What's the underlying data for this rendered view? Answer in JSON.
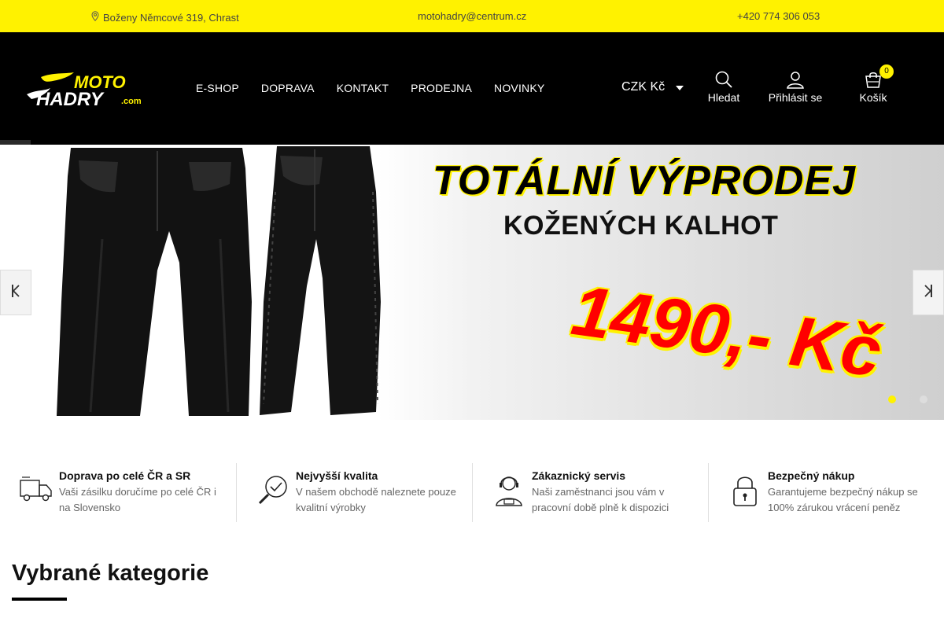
{
  "topbar": {
    "address": "Boženy Němcové 319, Chrast",
    "email": "motohadry@centrum.cz",
    "phone": "+420 774 306 053"
  },
  "logo": {
    "line1": "MOTO",
    "line2": "HADRY",
    "suffix": ".com"
  },
  "nav": {
    "items": [
      {
        "label": "E-SHOP"
      },
      {
        "label": "DOPRAVA"
      },
      {
        "label": "KONTAKT"
      },
      {
        "label": "PRODEJNA"
      },
      {
        "label": "NOVINKY"
      }
    ]
  },
  "header": {
    "currency": "CZK Kč",
    "search_label": "Hledat",
    "login_label": "Přihlásit se",
    "cart_label": "Košík",
    "cart_count": "0"
  },
  "hero": {
    "headline": "TOTÁLNÍ VÝPRODEJ",
    "subline": "KOŽENÝCH KALHOT",
    "price": "1490,- Kč",
    "active_slide": 1,
    "slide_count": 2
  },
  "features": [
    {
      "title": "Doprava po celé ČR a SR",
      "text": "Vaši zásilku doručíme po celé ČR i na Slovensko",
      "icon": "truck-icon"
    },
    {
      "title": "Nejvyšší kvalita",
      "text": "V našem obchodě naleznete pouze kvalitní výrobky",
      "icon": "quality-check-icon"
    },
    {
      "title": "Zákaznický servis",
      "text": "Naši zaměstnanci jsou vám v pracovní době plně k dispozici",
      "icon": "support-agent-icon"
    },
    {
      "title": "Bezpečný nákup",
      "text": "Garantujeme bezpečný nákup se 100% zárukou vrácení peněz",
      "icon": "padlock-icon"
    }
  ],
  "section": {
    "title": "Vybrané kategorie"
  },
  "colors": {
    "accent": "#fff200",
    "header_bg": "#000000",
    "price": "#ff0000"
  }
}
